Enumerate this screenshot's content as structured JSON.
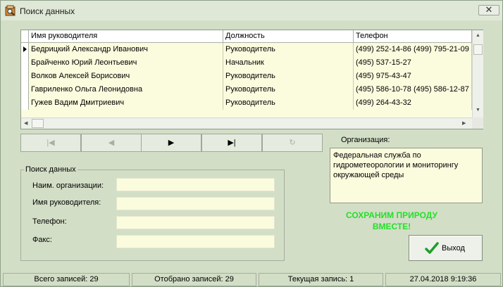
{
  "window": {
    "title": "Поиск данных",
    "close_symbol": "✕"
  },
  "grid": {
    "columns": [
      "Имя руководителя",
      "Должность",
      "Телефон"
    ],
    "rows": [
      {
        "name": "Бедрицкий Александр Иванович",
        "position": "Руководитель",
        "phone": "(499) 252-14-86 (499) 795-21-09"
      },
      {
        "name": "Брайченко Юрий Леонтьевич",
        "position": "Начальник",
        "phone": "(495) 537-15-27"
      },
      {
        "name": "Волков Алексей Борисович",
        "position": "Руководитель",
        "phone": "(495) 975-43-47"
      },
      {
        "name": "Гавриленко Ольга Леонидовна",
        "position": "Руководитель",
        "phone": "(495) 586-10-78 (495) 586-12-87"
      },
      {
        "name": "Гужев Вадим Дмитриевич",
        "position": "Руководитель",
        "phone": "(499) 264-43-32"
      }
    ]
  },
  "navigator": {
    "buttons": [
      {
        "symbol": "|◀",
        "enabled": false
      },
      {
        "symbol": "◀",
        "enabled": false
      },
      {
        "symbol": "▶",
        "enabled": true
      },
      {
        "symbol": "▶|",
        "enabled": true
      },
      {
        "symbol": "↻",
        "enabled": false
      }
    ]
  },
  "organization": {
    "label": "Организация:",
    "value": "Федеральная служба по гидрометеорологии и мониторингу окружающей среды"
  },
  "search": {
    "legend": "Поиск данных",
    "fields": [
      {
        "label": "Наим. организации:",
        "value": ""
      },
      {
        "label": "Имя руководителя:",
        "value": ""
      },
      {
        "label": "Телефон:",
        "value": ""
      },
      {
        "label": "Факс:",
        "value": ""
      }
    ]
  },
  "slogan": {
    "line1": "СОХРАНИМ ПРИРОДУ",
    "line2": "ВМЕСТЕ!",
    "color": "#23e02a"
  },
  "exit_button": {
    "label": "Выход",
    "icon": "checkmark-icon"
  },
  "status": {
    "total": "Всего записей: 29",
    "selected": "Отобрано записей: 29",
    "current": "Текущая запись: 1",
    "datetime": "27.04.2018 9:19:36"
  }
}
